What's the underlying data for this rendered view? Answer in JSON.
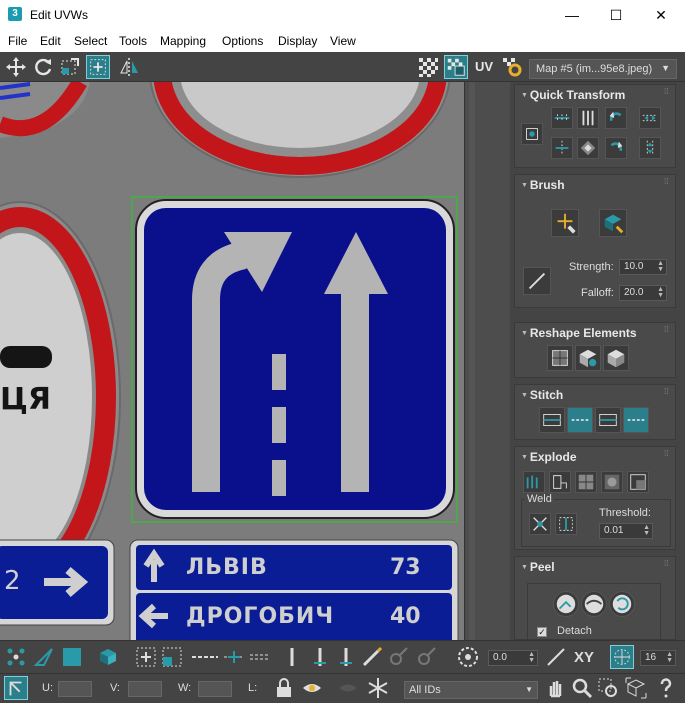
{
  "window": {
    "title": "Edit UVWs",
    "app_icon": "3",
    "minimize": "—",
    "maximize": "☐",
    "close": "✕"
  },
  "menu": [
    "File",
    "Edit",
    "Select",
    "Tools",
    "Mapping",
    "Options",
    "Display",
    "View"
  ],
  "toolbar": {
    "uv_label": "UV",
    "map_select": "Map #5 (im...95e8.jpeg)"
  },
  "viewport": {
    "sign_right": {
      "city1": "ЛЬВІВ",
      "dist1": "73",
      "city2": "ДРОГОБИЧ",
      "dist2": "40"
    },
    "sign_left": {
      "number": "2"
    },
    "round_sign_text": "ЦЯ"
  },
  "panel": {
    "quick_transform": {
      "title": "Quick Transform"
    },
    "brush": {
      "title": "Brush",
      "strength_label": "Strength:",
      "strength_value": "10.0",
      "falloff_label": "Falloff:",
      "falloff_value": "20.0"
    },
    "reshape": {
      "title": "Reshape Elements"
    },
    "stitch": {
      "title": "Stitch"
    },
    "explode": {
      "title": "Explode",
      "weld_label": "Weld",
      "threshold_label": "Threshold:",
      "threshold_value": "0.01"
    },
    "peel": {
      "title": "Peel",
      "detach_label": "Detach"
    }
  },
  "bottom": {
    "angle_value": "0.0",
    "xy_label": "XY",
    "count_value": "16",
    "u_label": "U:",
    "v_label": "V:",
    "w_label": "W:",
    "l_label": "L:",
    "ids_select": "All IDs"
  },
  "colors": {
    "accent_teal": "#2a9aa8",
    "sign_blue": "#0a0f8c",
    "sign_red": "#c3161a",
    "panel_bg": "#444444"
  }
}
